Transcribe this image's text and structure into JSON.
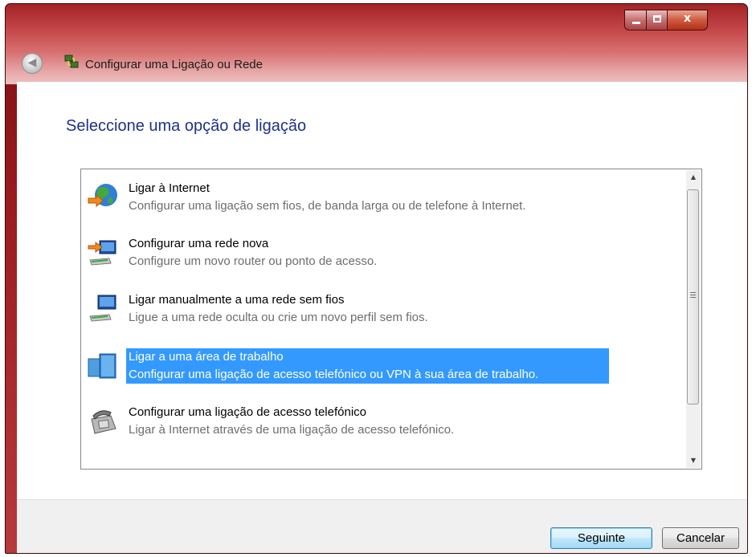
{
  "window": {
    "title": "Configurar uma Ligação ou Rede",
    "controls": {
      "minimize": "minimize",
      "maximize": "maximize",
      "close": "x"
    }
  },
  "main": {
    "heading": "Seleccione uma opção de ligação",
    "options": [
      {
        "title": "Ligar à Internet",
        "description": "Configurar uma ligação sem fios, de banda larga ou de telefone à Internet.",
        "icon": "globe-icon",
        "selected": false
      },
      {
        "title": "Configurar uma rede nova",
        "description": "Configure um novo router ou ponto de acesso.",
        "icon": "new-network-icon",
        "selected": false
      },
      {
        "title": "Ligar manualmente a uma rede sem fios",
        "description": "Ligue a uma rede oculta ou crie um novo perfil sem fios.",
        "icon": "wireless-network-icon",
        "selected": false
      },
      {
        "title": "Ligar a uma área de trabalho",
        "description": "Configurar uma ligação de acesso telefónico ou VPN à sua área de trabalho.",
        "icon": "workplace-icon",
        "selected": true
      },
      {
        "title": "Configurar uma ligação de acesso telefónico",
        "description": "Ligar à Internet através de uma ligação de acesso telefónico.",
        "icon": "telephone-icon",
        "selected": false
      }
    ]
  },
  "footer": {
    "next_label": "Seguinte",
    "cancel_label": "Cancelar"
  },
  "colors": {
    "title_bar": "#a12326",
    "heading": "#1e3287",
    "selection": "#3399ff"
  }
}
